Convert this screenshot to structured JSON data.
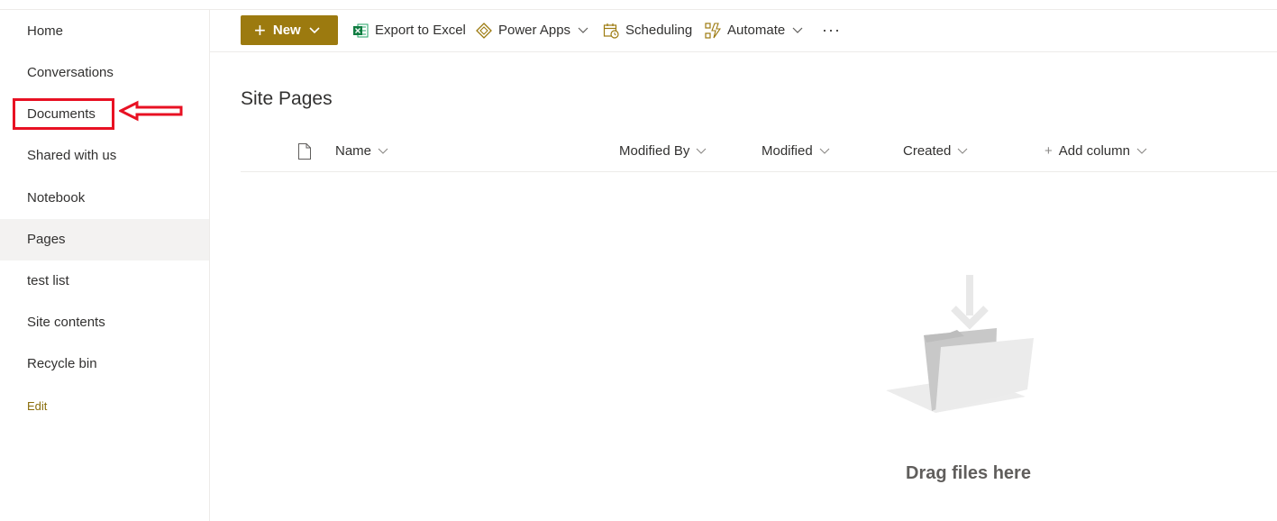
{
  "sidebar": {
    "items": [
      {
        "label": "Home"
      },
      {
        "label": "Conversations"
      },
      {
        "label": "Documents"
      },
      {
        "label": "Shared with us"
      },
      {
        "label": "Notebook"
      },
      {
        "label": "Pages",
        "selected": true
      },
      {
        "label": "test list"
      },
      {
        "label": "Site contents"
      },
      {
        "label": "Recycle bin"
      }
    ],
    "edit_label": "Edit"
  },
  "toolbar": {
    "new_label": "New",
    "export_label": "Export to Excel",
    "powerapps_label": "Power Apps",
    "scheduling_label": "Scheduling",
    "automate_label": "Automate",
    "more_label": "···"
  },
  "main": {
    "title": "Site Pages",
    "columns": {
      "name": "Name",
      "modified_by": "Modified By",
      "modified": "Modified",
      "created": "Created",
      "add_column": "Add column"
    },
    "empty_text": "Drag files here"
  },
  "colors": {
    "accent": "#9c7a0f",
    "annotation": "#e81123",
    "selected_bg": "#f3f2f1"
  }
}
